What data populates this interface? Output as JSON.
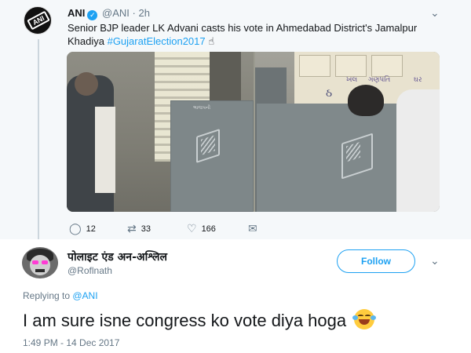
{
  "quoted_tweet": {
    "author_name": "ANI",
    "author_handle": "@ANI",
    "separator": "·",
    "time": "2h",
    "text": "Senior BJP leader LK Advani casts his vote in Ahmedabad District's Jamalpur Khadiya ",
    "hashtag": "#GujaratElection2017",
    "inked_finger": "☝",
    "avatar_logo": "ANI",
    "actions": {
      "replies": "12",
      "retweets": "33",
      "likes": "166"
    },
    "photo_text": {
      "booth_label_left": "ભાજપની",
      "poster_1": "ખલ",
      "poster_2": "ગણપતિ",
      "poster_3": "ઘર",
      "poster_4": "ઠ",
      "poster_5": "ડ",
      "poster_6": "ણ"
    }
  },
  "reply_tweet": {
    "author_name": "पोलाइट एंड अन-अश्लिल",
    "author_handle": "@Roflnath",
    "follow_label": "Follow",
    "replying_prefix": "Replying to ",
    "replying_to": "@ANI",
    "text": "I am sure isne congress ko vote diya hoga",
    "timestamp": "1:49 PM - 14 Dec 2017"
  },
  "icons": {
    "reply": "reply-icon",
    "retweet": "retweet-icon",
    "like": "heart-icon",
    "dm": "envelope-icon",
    "more": "chevron-down-icon",
    "verified": "verified-badge-icon",
    "emoji": "face-with-tears-of-joy"
  },
  "colors": {
    "accent": "#1da1f2",
    "secondary_text": "#657786",
    "quoted_background": "#f5f8fa"
  }
}
